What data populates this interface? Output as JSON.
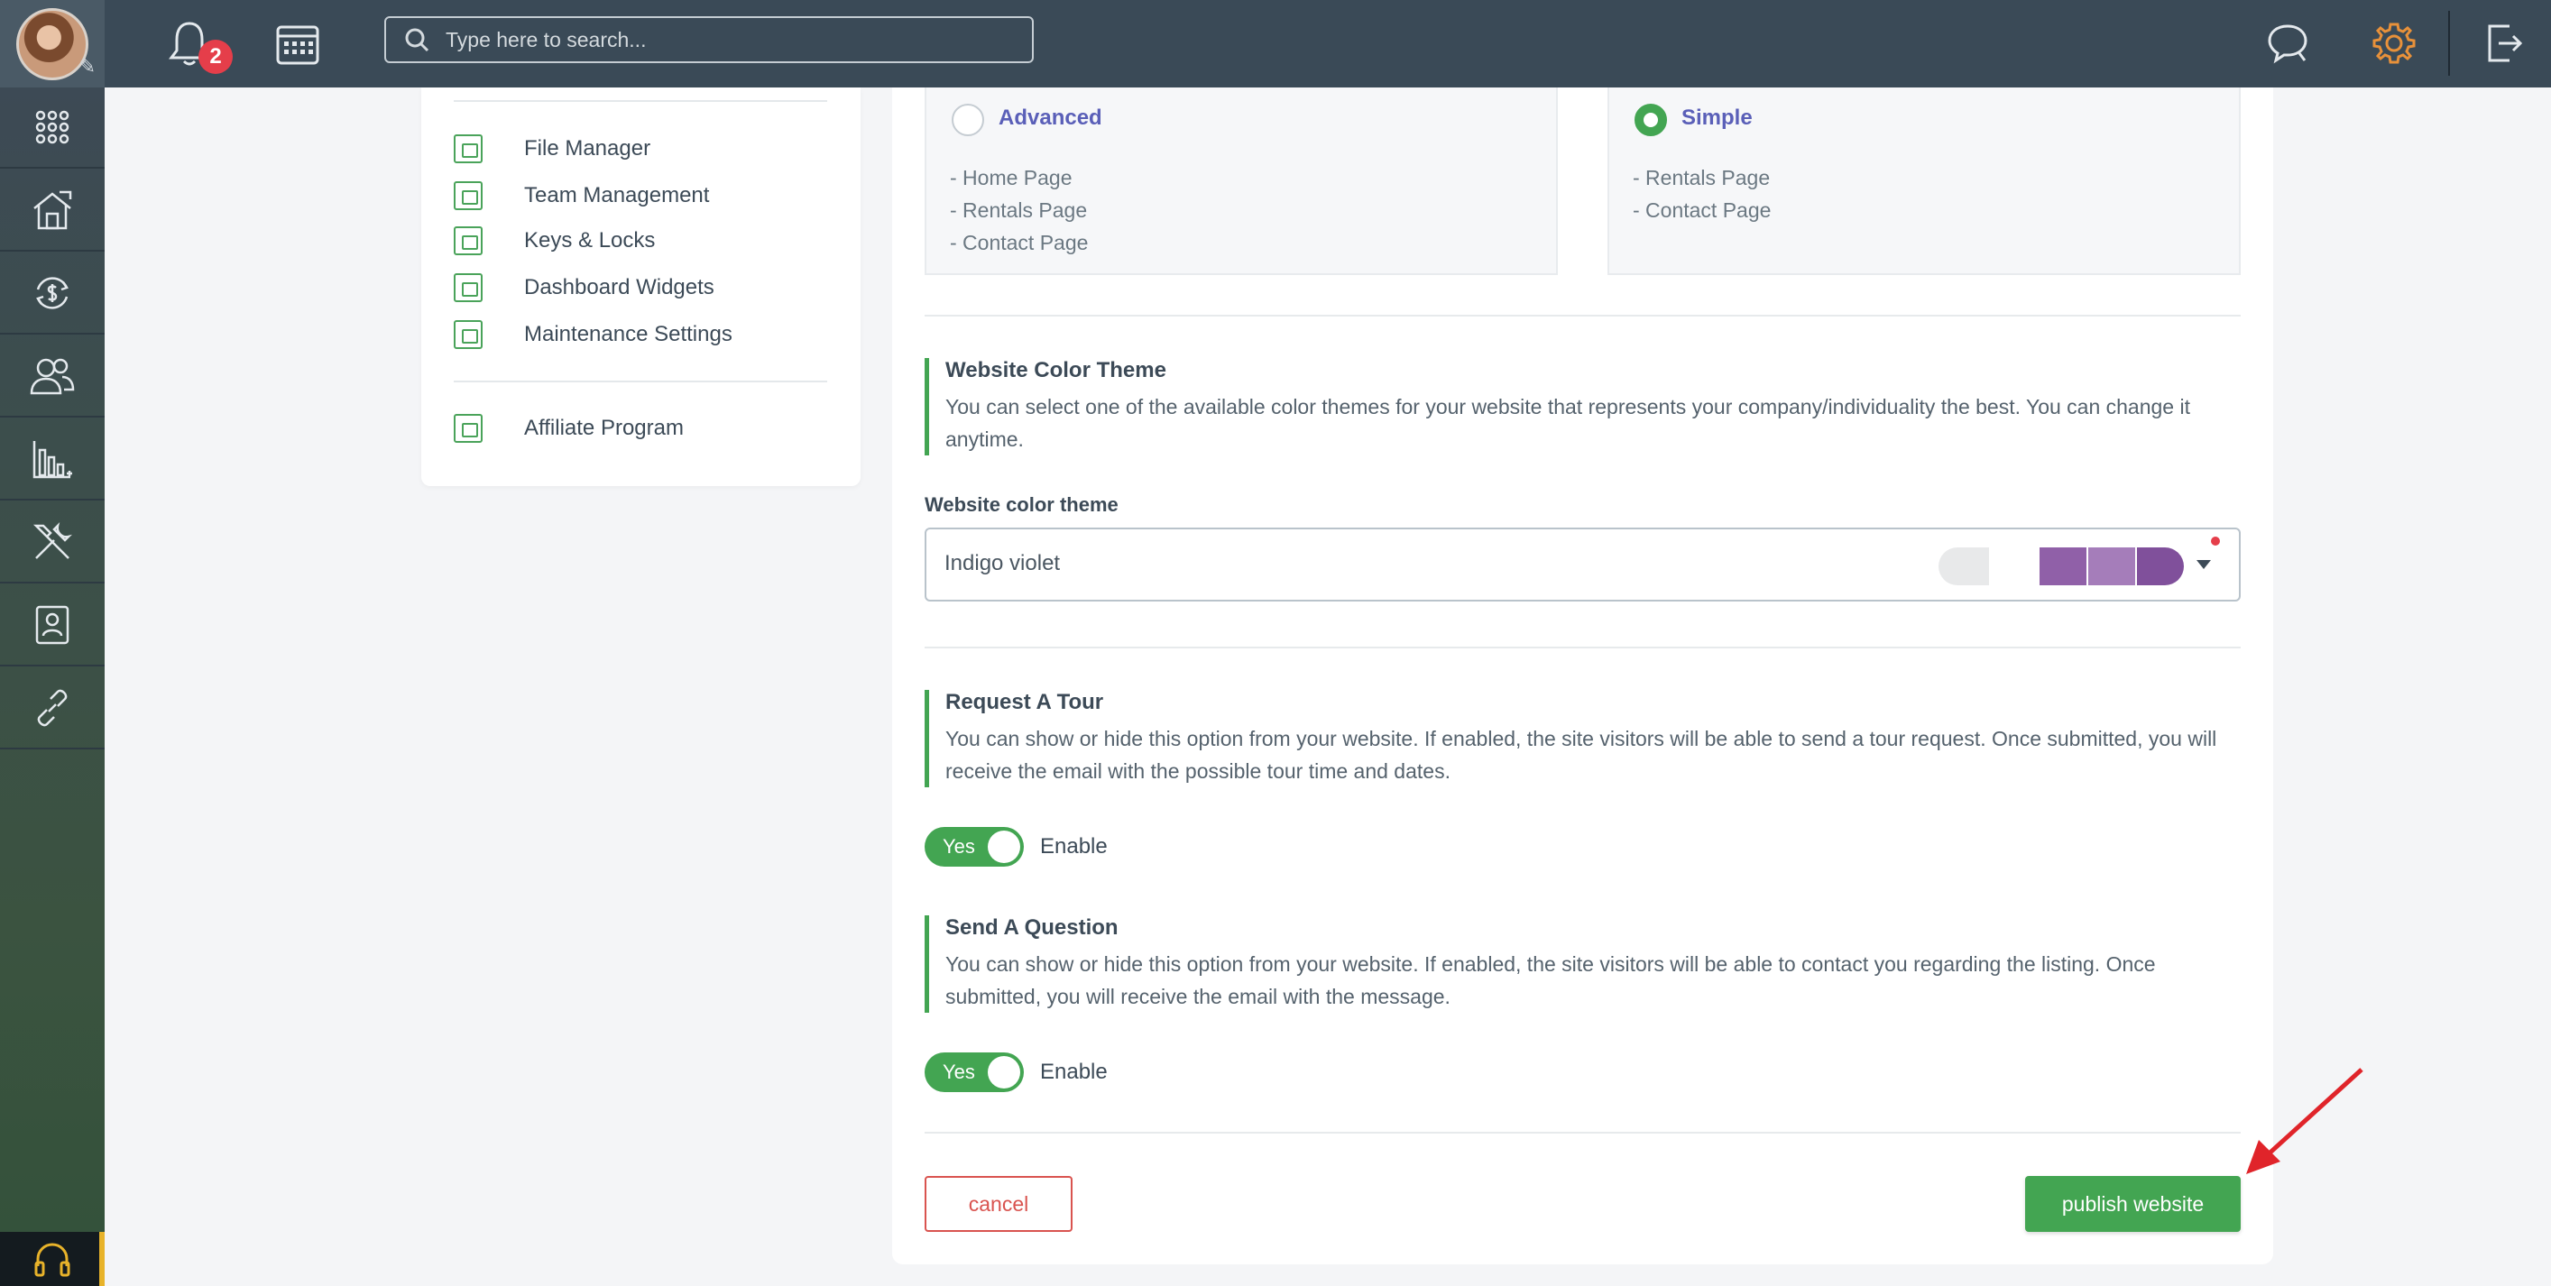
{
  "topbar": {
    "notification_count": "2",
    "search_placeholder": "Type here to search..."
  },
  "sidebar_rail": {
    "items": [
      "apps-grid-icon",
      "properties-icon",
      "payments-icon",
      "tenants-icon",
      "reports-icon",
      "tools-icon",
      "contacts-icon",
      "links-icon"
    ],
    "bottom": "support-headset-icon"
  },
  "settings_menu": {
    "items": [
      {
        "label": "File Manager"
      },
      {
        "label": "Team Management"
      },
      {
        "label": "Keys & Locks"
      },
      {
        "label": "Dashboard Widgets"
      },
      {
        "label": "Maintenance Settings"
      }
    ],
    "extra": {
      "label": "Affiliate Program"
    }
  },
  "layouts": {
    "advanced": {
      "name": "Advanced",
      "pages": [
        "- Home Page",
        "- Rentals Page",
        "- Contact Page"
      ],
      "selected": false
    },
    "simple": {
      "name": "Simple",
      "pages": [
        "- Rentals Page",
        "- Contact Page"
      ],
      "selected": true
    }
  },
  "color_theme": {
    "heading": "Website Color Theme",
    "description": "You can select one of the available color themes for your website that represents your company/individuality the best. You can change it anytime.",
    "field_label": "Website color theme",
    "selected": "Indigo violet",
    "swatches": [
      "#9060a8",
      "#a57dba",
      "#80509b"
    ]
  },
  "request_tour": {
    "heading": "Request A Tour",
    "description": "You can show or hide this option from your website. If enabled, the site visitors will be able to send a tour request. Once submitted, you will receive the email with the possible tour time and dates.",
    "toggle_label": "Yes",
    "state_label": "Enable"
  },
  "send_question": {
    "heading": "Send A Question",
    "description": "You can show or hide this option from your website. If enabled, the site visitors will be able to contact you regarding the listing. Once submitted, you will receive the email with the message.",
    "toggle_label": "Yes",
    "state_label": "Enable"
  },
  "actions": {
    "cancel": "cancel",
    "publish": "publish website"
  },
  "colors": {
    "accent_green": "#43a552",
    "danger_red": "#d9534f",
    "topbar": "#3a4a57",
    "link_indigo": "#5a5fb8"
  }
}
